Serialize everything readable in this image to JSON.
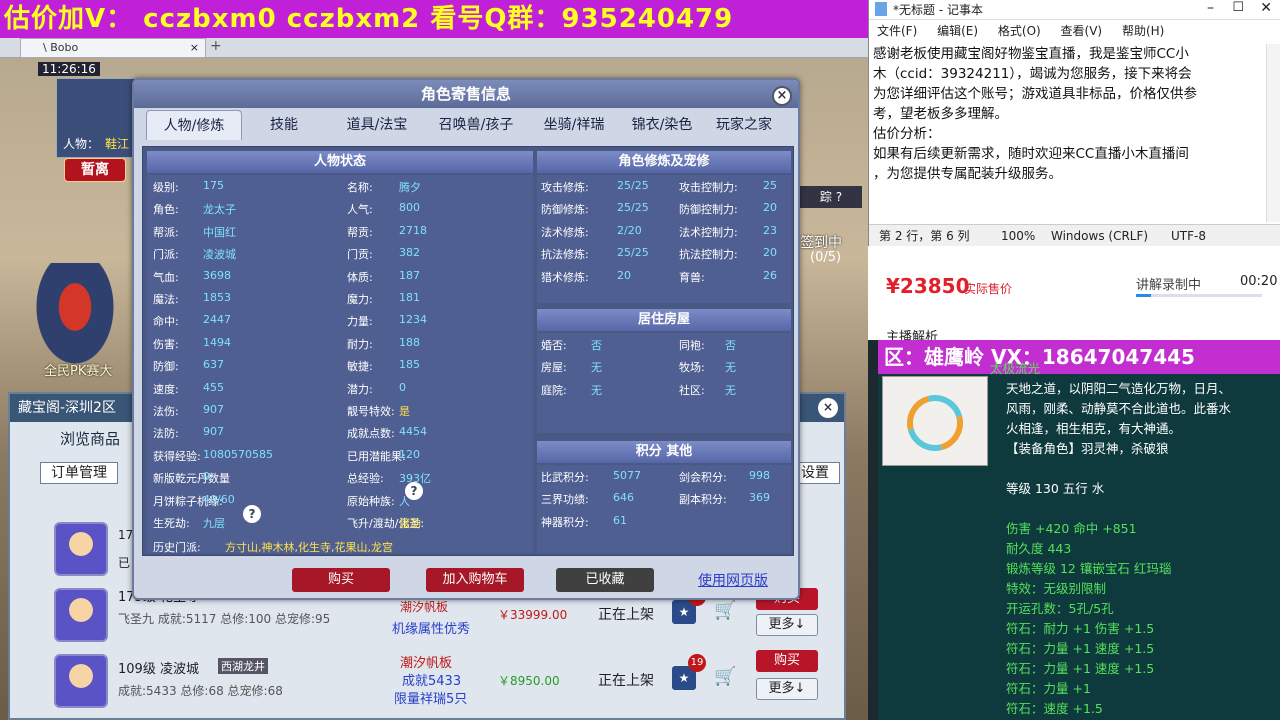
{
  "banner": "估价加V：  cczbxm0   cczbxm2   看号Q群：935240479",
  "game_tab": {
    "label": "\\ Bobo"
  },
  "game": {
    "time": "11:26:16",
    "char_label": "人物：",
    "char_name": "鞋江",
    "leave_btn": "暂离",
    "left_label": "全民PK赛大",
    "checkin": "签到中",
    "checkin_count": "(0/5)"
  },
  "market": {
    "title": "藏宝阁-深圳2区",
    "browse": "浏览商品",
    "order_mgmt": "订单管理",
    "settings": "设置",
    "rows": [
      {
        "level": "17",
        "line2": "已",
        "status": "",
        "price": ""
      },
      {
        "level": "175级",
        "name": "化生寺",
        "stats": "飞圣九 成就:5117 总修:100 总宠修:95",
        "tag1": "潮汐帆板",
        "tag2": "机缘属性优秀",
        "price": "￥33999.00",
        "status": "正在上架",
        "badge": "11"
      },
      {
        "level": "109级",
        "name": "凌波城",
        "server": "西湖龙井",
        "stats": "成就:5433 总修:68 总宠修:68",
        "tag1": "潮汐帆板",
        "tag2": "成就5433",
        "tag3": "限量祥瑞5只",
        "price": "￥8950.00",
        "status": "正在上架",
        "badge": "19"
      }
    ],
    "buy": "购买",
    "more": "更多↓"
  },
  "dialog": {
    "title": "角色寄售信息",
    "close": "×",
    "tabs": [
      "人物/修炼",
      "技能",
      "道具/法宝",
      "召唤兽/孩子",
      "坐骑/祥瑞",
      "锦衣/染色",
      "玩家之家"
    ],
    "status_header": "人物状态",
    "status": [
      {
        "k": "级别:",
        "v": "175"
      },
      {
        "k": "名称:",
        "v": "腾夕"
      },
      {
        "k": "角色:",
        "v": "龙太子"
      },
      {
        "k": "人气:",
        "v": "800"
      },
      {
        "k": "帮派:",
        "v": "中国红"
      },
      {
        "k": "帮贡:",
        "v": "2718"
      },
      {
        "k": "门派:",
        "v": "凌波城"
      },
      {
        "k": "门贡:",
        "v": "382"
      },
      {
        "k": "气血:",
        "v": "3698"
      },
      {
        "k": "体质:",
        "v": "187"
      },
      {
        "k": "魔法:",
        "v": "1853"
      },
      {
        "k": "魔力:",
        "v": "181"
      },
      {
        "k": "命中:",
        "v": "2447"
      },
      {
        "k": "力量:",
        "v": "1234"
      },
      {
        "k": "伤害:",
        "v": "1494"
      },
      {
        "k": "耐力:",
        "v": "188"
      },
      {
        "k": "防御:",
        "v": "637"
      },
      {
        "k": "敏捷:",
        "v": "185"
      },
      {
        "k": "速度:",
        "v": "455"
      },
      {
        "k": "潜力:",
        "v": "0"
      },
      {
        "k": "法伤:",
        "v": "907"
      },
      {
        "k": "靓号特效:",
        "v": "是"
      },
      {
        "k": "法防:",
        "v": "907"
      },
      {
        "k": "成就点数:",
        "v": "4454"
      },
      {
        "k": "获得经验:",
        "v": "1080570585"
      },
      {
        "k": "已用潜能果:",
        "v": "120"
      },
      {
        "k": "新版乾元丹数量",
        "v": "9"
      },
      {
        "k": "总经验:",
        "v": "393亿"
      },
      {
        "k": "月饼粽子机缘:",
        "v": "40/60"
      },
      {
        "k": "原始种族:",
        "v": "人"
      },
      {
        "k": "生死劫:",
        "v": "九层"
      },
      {
        "k": "飞升/渡劫/化圣:",
        "v": "渡劫"
      }
    ],
    "history_label": "历史门派:",
    "history": "方寸山,神木林,化生寺,花果山,龙宫",
    "cult_header": "角色修炼及宠修",
    "cult": [
      {
        "k": "攻击修炼:",
        "v": "25/25"
      },
      {
        "k": "攻击控制力:",
        "v": "25"
      },
      {
        "k": "防御修炼:",
        "v": "25/25"
      },
      {
        "k": "防御控制力:",
        "v": "20"
      },
      {
        "k": "法术修炼:",
        "v": "2/20"
      },
      {
        "k": "法术控制力:",
        "v": "23"
      },
      {
        "k": "抗法修炼:",
        "v": "25/25"
      },
      {
        "k": "抗法控制力:",
        "v": "20"
      },
      {
        "k": "猎术修炼:",
        "v": "20"
      },
      {
        "k": "育兽:",
        "v": "26"
      }
    ],
    "house_header": "居住房屋",
    "house": [
      {
        "k": "婚否:",
        "v": "否"
      },
      {
        "k": "同袍:",
        "v": "否"
      },
      {
        "k": "房屋:",
        "v": "无"
      },
      {
        "k": "牧场:",
        "v": "无"
      },
      {
        "k": "庭院:",
        "v": "无"
      },
      {
        "k": "社区:",
        "v": "无"
      }
    ],
    "score_header": "积分 其他",
    "score": [
      {
        "k": "比武积分:",
        "v": "5077"
      },
      {
        "k": "剑会积分:",
        "v": "998"
      },
      {
        "k": "三界功绩:",
        "v": "646"
      },
      {
        "k": "副本积分:",
        "v": "369"
      },
      {
        "k": "神器积分:",
        "v": "61"
      }
    ],
    "btn_buy": "购买",
    "btn_cart": "加入购物车",
    "btn_fav": "已收藏",
    "btn_web": "使用网页版"
  },
  "notepad": {
    "title": "*无标题 - 记事本",
    "menu": [
      "文件(F)",
      "编辑(E)",
      "格式(O)",
      "查看(V)",
      "帮助(H)"
    ],
    "lines": [
      "感谢老板使用藏宝阁好物鉴宝直播，我是鉴宝师CC小",
      "木（ccid：39324211），竭诚为您服务，接下来将会",
      "为您详细评估这个账号；游戏道具非标品，价格仅供参",
      "考，望老板多多理解。",
      "估价分析：",
      "如果有后续更新需求，随时欢迎来CC直播小木直播间",
      "，为您提供专属配装升级服务。"
    ],
    "status": {
      "pos": "第 2 行，第 6 列",
      "zoom": "100%",
      "eol": "Windows (CRLF)",
      "enc": "UTF-8"
    }
  },
  "live": {
    "price": "¥23850",
    "price_label": "实际售价",
    "recording": "讲解录制中",
    "time": "00:20",
    "host": "主播解析"
  },
  "item": {
    "header": "区：雄鹰岭  VX：18647047445",
    "name": "太极流光",
    "desc": [
      "天地之道，以阴阳二气造化万物，日月、",
      "风雨，刚柔、动静莫不合此道也。此番水",
      "火相逢，相生相克，有大神通。"
    ],
    "role": "【装备角色】羽灵神，杀破狼",
    "level": "等级 130 五行 水",
    "atk": "伤害 +420 命中 +851",
    "dur": "耐久度 443",
    "forge": "锻炼等级 12 镶嵌宝石 红玛瑙",
    "effect": "特效：无级别限制",
    "holes": "开运孔数：5孔/5孔",
    "runes": [
      "符石：耐力 +1 伤害 +1.5",
      "符石：力量 +1 速度 +1.5",
      "符石：力量 +1 速度 +1.5",
      "符石：力量 +1",
      "符石：速度 +1.5"
    ]
  }
}
